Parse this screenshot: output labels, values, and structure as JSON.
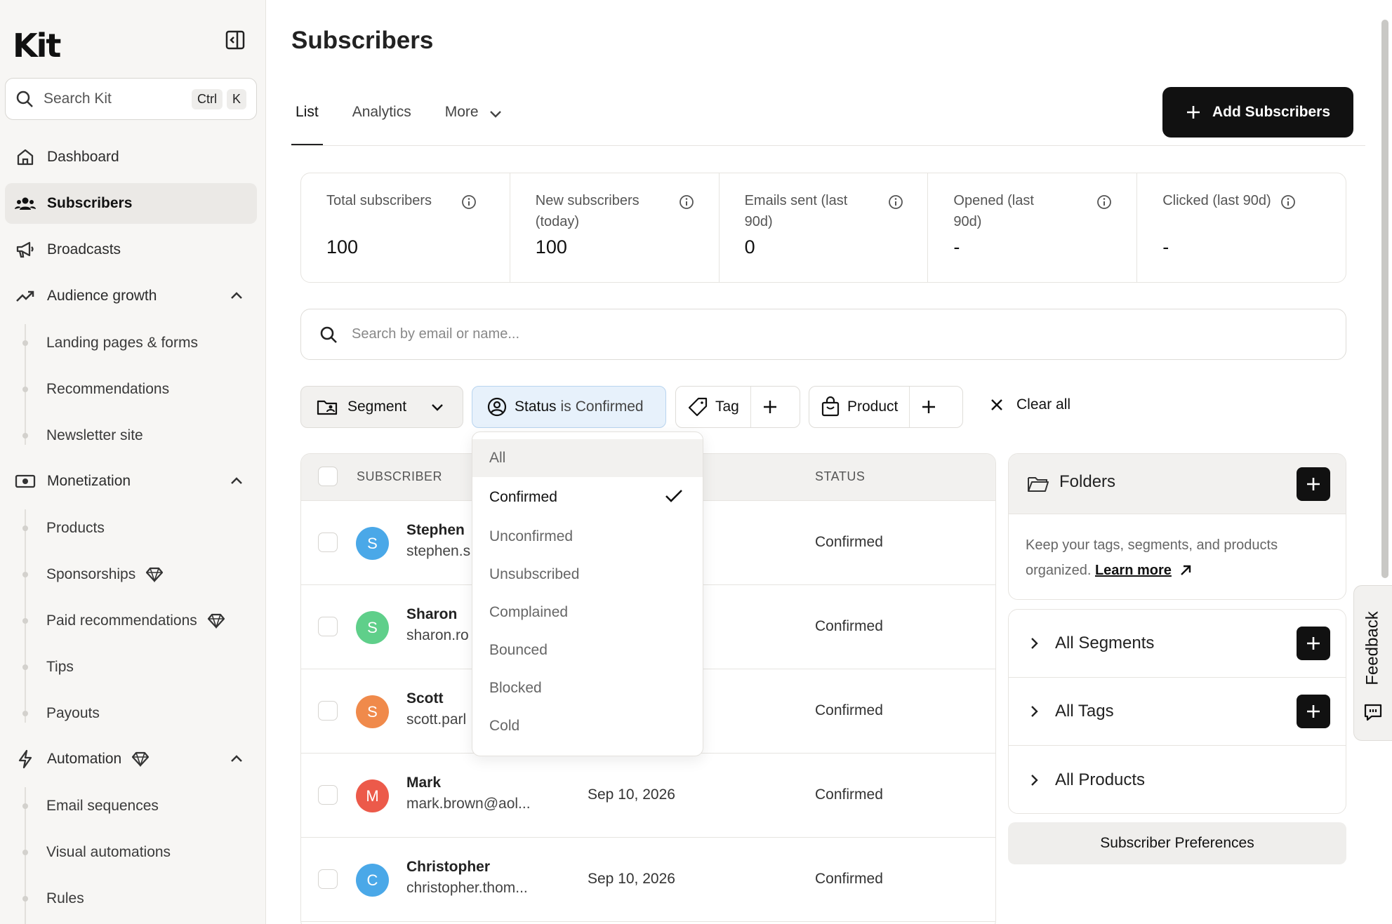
{
  "app": {
    "logo": "Kit"
  },
  "sidebar": {
    "search": {
      "placeholder": "Search Kit",
      "shortcut_1": "Ctrl",
      "shortcut_2": "K"
    },
    "items": {
      "dashboard": "Dashboard",
      "subscribers": "Subscribers",
      "broadcasts": "Broadcasts",
      "audience_growth": "Audience growth",
      "monetization": "Monetization",
      "automation": "Automation"
    },
    "audience_growth_sub": [
      "Landing pages & forms",
      "Recommendations",
      "Newsletter site"
    ],
    "monetization_sub": [
      "Products",
      "Sponsorships",
      "Paid recommendations",
      "Tips",
      "Payouts"
    ],
    "automation_sub": [
      "Email sequences",
      "Visual automations",
      "Rules"
    ]
  },
  "header": {
    "title": "Subscribers",
    "tabs": [
      "List",
      "Analytics",
      "More"
    ],
    "add_button": "Add Subscribers"
  },
  "stats": [
    {
      "label": "Total subscribers",
      "value": "100"
    },
    {
      "label": "New subscribers (today)",
      "value": "100"
    },
    {
      "label": "Emails sent (last 90d)",
      "value": "0"
    },
    {
      "label": "Opened (last 90d)",
      "value": "-"
    },
    {
      "label": "Clicked (last 90d)",
      "value": "-"
    }
  ],
  "search": {
    "placeholder": "Search by email or name..."
  },
  "filters": {
    "segment": "Segment",
    "status_prefix": "Status",
    "status_is": "is",
    "status_value": "Confirmed",
    "tag": "Tag",
    "product": "Product",
    "clear_all": "Clear all"
  },
  "status_dropdown": {
    "options": [
      "All",
      "Confirmed",
      "Unconfirmed",
      "Unsubscribed",
      "Complained",
      "Bounced",
      "Blocked",
      "Cold"
    ],
    "selected": "Confirmed"
  },
  "table": {
    "columns": [
      "SUBSCRIBER",
      "STATUS"
    ],
    "rows": [
      {
        "initial": "S",
        "name": "Stephen",
        "email": "stephen.s",
        "date": "",
        "status": "Confirmed",
        "color": "#4aa8e8"
      },
      {
        "initial": "S",
        "name": "Sharon",
        "email": "sharon.ro",
        "date": "",
        "status": "Confirmed",
        "color": "#5fcf8a"
      },
      {
        "initial": "S",
        "name": "Scott",
        "email": "scott.parl",
        "date": "",
        "status": "Confirmed",
        "color": "#f08a4b"
      },
      {
        "initial": "M",
        "name": "Mark",
        "email": "mark.brown@aol...",
        "date": "Sep 10, 2026",
        "status": "Confirmed",
        "color": "#ec5a4a"
      },
      {
        "initial": "C",
        "name": "Christopher",
        "email": "christopher.thom...",
        "date": "Sep 10, 2026",
        "status": "Confirmed",
        "color": "#4aa8e8"
      }
    ]
  },
  "folders": {
    "title": "Folders",
    "description": "Keep your tags, segments, and products organized.",
    "learn_more": "Learn more",
    "lists": [
      "All Segments",
      "All Tags",
      "All Products"
    ],
    "preferences": "Subscriber Preferences"
  },
  "feedback": {
    "label": "Feedback"
  }
}
